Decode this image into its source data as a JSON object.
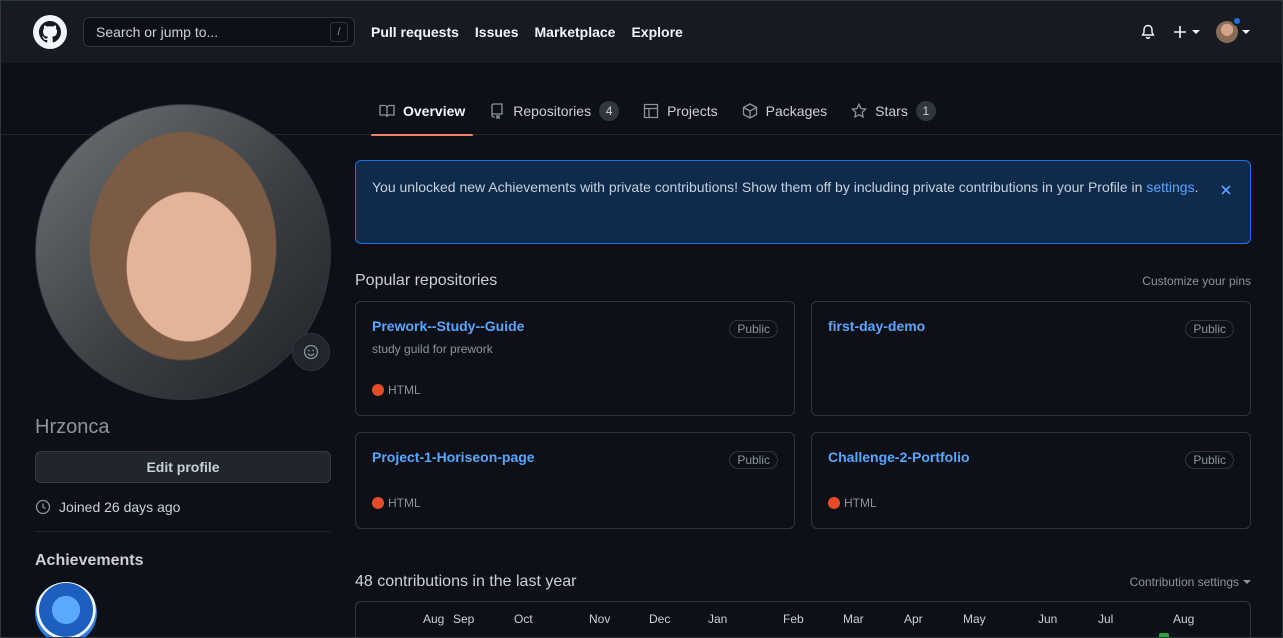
{
  "header": {
    "search_placeholder": "Search or jump to...",
    "search_shortcut": "/",
    "nav": [
      "Pull requests",
      "Issues",
      "Marketplace",
      "Explore"
    ]
  },
  "tabs": [
    {
      "label": "Overview",
      "icon": "book-icon",
      "active": true
    },
    {
      "label": "Repositories",
      "icon": "repo-icon",
      "count": "4"
    },
    {
      "label": "Projects",
      "icon": "table-icon"
    },
    {
      "label": "Packages",
      "icon": "package-icon"
    },
    {
      "label": "Stars",
      "icon": "star-icon",
      "count": "1"
    }
  ],
  "profile": {
    "username": "Hrzonca",
    "edit_label": "Edit profile",
    "joined": "Joined 26 days ago",
    "achievements_title": "Achievements"
  },
  "flash": {
    "text": "You unlocked new Achievements with private contributions! Show them off by including private contributions in your Profile in ",
    "link": "settings",
    "end": "."
  },
  "popular": {
    "title": "Popular repositories",
    "customize": "Customize your pins",
    "repos": [
      {
        "name": "Prework--Study--Guide",
        "visibility": "Public",
        "description": "study guild for prework",
        "language": "HTML"
      },
      {
        "name": "first-day-demo",
        "visibility": "Public",
        "description": "",
        "language": ""
      },
      {
        "name": "Project-1-Horiseon-page",
        "visibility": "Public",
        "description": "",
        "language": "HTML"
      },
      {
        "name": "Challenge-2-Portfolio",
        "visibility": "Public",
        "description": "",
        "language": "HTML"
      }
    ]
  },
  "contributions": {
    "title": "48 contributions in the last year",
    "settings": "Contribution settings",
    "months": [
      "Aug",
      "Sep",
      "Oct",
      "Nov",
      "Dec",
      "Jan",
      "Feb",
      "Mar",
      "Apr",
      "May",
      "Jun",
      "Jul",
      "Aug"
    ]
  },
  "colors": {
    "accent": "#58a6ff",
    "tab_underline": "#f78166",
    "html_lang": "#e34c26"
  }
}
